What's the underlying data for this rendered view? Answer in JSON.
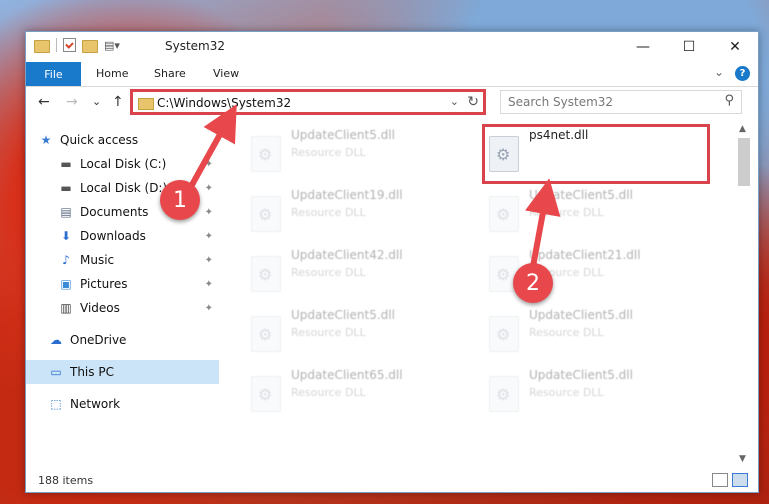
{
  "window": {
    "title": "System32",
    "minimize": "—",
    "maximize": "☐",
    "close": "✕"
  },
  "ribbon": {
    "file": "File",
    "tabs": [
      "Home",
      "Share",
      "View"
    ],
    "help": "?"
  },
  "navigation": {
    "back": "←",
    "forward": "→",
    "recent": "⌄",
    "up": "↑"
  },
  "address": {
    "path": "C:\\Windows\\System32",
    "dropdown": "⌄",
    "refresh": "↻"
  },
  "search": {
    "placeholder": "Search System32",
    "icon": "⚲"
  },
  "sidebar": {
    "items": [
      {
        "label": "Quick access",
        "icon": "★"
      },
      {
        "label": "Local Disk (C:)",
        "icon": "▬"
      },
      {
        "label": "Local Disk (D:)",
        "icon": "▬"
      },
      {
        "label": "Documents",
        "icon": "▤"
      },
      {
        "label": "Downloads",
        "icon": "⬇"
      },
      {
        "label": "Music",
        "icon": "♪"
      },
      {
        "label": "Pictures",
        "icon": "▣"
      },
      {
        "label": "Videos",
        "icon": "▥"
      },
      {
        "label": "OneDrive",
        "icon": "☁"
      },
      {
        "label": "This PC",
        "icon": "▭"
      },
      {
        "label": "Network",
        "icon": "⬚"
      }
    ],
    "pin": "📌"
  },
  "files": [
    {
      "name": "UpdateClient5.dll",
      "type": "Resource DLL"
    },
    {
      "name": "ps4net.dll",
      "type": ""
    },
    {
      "name": "UpdateClient19.dll",
      "type": "Resource DLL"
    },
    {
      "name": "UpdateClient5.dll",
      "type": "Resource DLL"
    },
    {
      "name": "UpdateClient42.dll",
      "type": "Resource DLL"
    },
    {
      "name": "UpdateClient21.dll",
      "type": "Resource DLL"
    },
    {
      "name": "UpdateClient5.dll",
      "type": "Resource DLL"
    },
    {
      "name": "UpdateClient5.dll",
      "type": "Resource DLL"
    },
    {
      "name": "UpdateClient65.dll",
      "type": "Resource DLL"
    },
    {
      "name": "UpdateClient5.dll",
      "type": "Resource DLL"
    }
  ],
  "status": {
    "count": "188 items"
  },
  "annotations": {
    "step1": "1",
    "step2": "2",
    "color": "#e8474b"
  }
}
